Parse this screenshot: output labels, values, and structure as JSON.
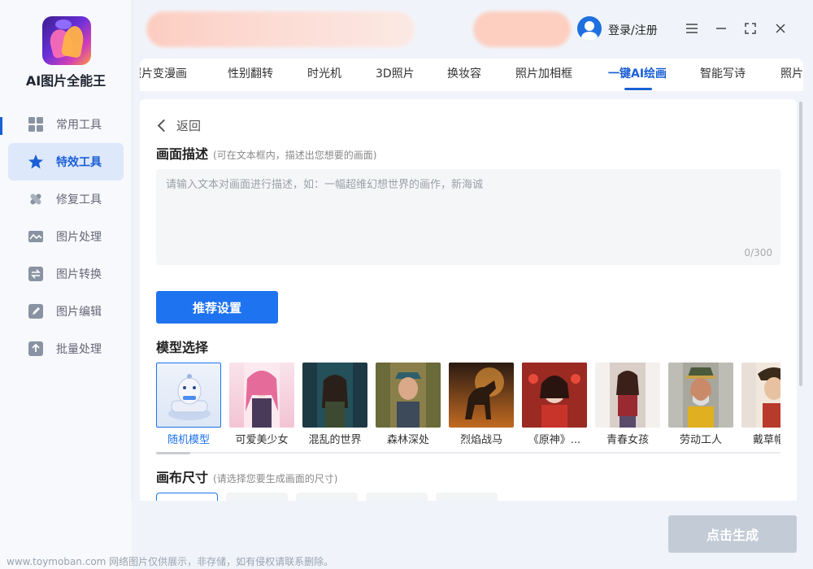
{
  "app": {
    "name": "AI图片全能王"
  },
  "header": {
    "login": "登录/注册"
  },
  "sidebar": {
    "items": [
      {
        "label": "常用工具",
        "icon": "grid-icon"
      },
      {
        "label": "特效工具",
        "icon": "star-icon",
        "active": true
      },
      {
        "label": "修复工具",
        "icon": "bandage-icon"
      },
      {
        "label": "图片处理",
        "icon": "image-icon"
      },
      {
        "label": "图片转换",
        "icon": "convert-icon"
      },
      {
        "label": "图片编辑",
        "icon": "edit-icon"
      },
      {
        "label": "批量处理",
        "icon": "upload-icon"
      }
    ]
  },
  "tabs": [
    {
      "label": "照片变漫画"
    },
    {
      "label": "性别翻转"
    },
    {
      "label": "时光机"
    },
    {
      "label": "3D照片"
    },
    {
      "label": "换妆容"
    },
    {
      "label": "照片加相框"
    },
    {
      "label": "一键AI绘画",
      "active": true
    },
    {
      "label": "智能写诗"
    },
    {
      "label": "照片"
    }
  ],
  "main": {
    "back": "返回",
    "description": {
      "title": "画面描述",
      "hint": "(可在文本框内，描述出您想要的画面)",
      "placeholder": "请输入文本对画面进行描述，如：一幅超维幻想世界的画作，新海诚",
      "counter": "0/300"
    },
    "recommend_button": "推荐设置",
    "model_section": {
      "title": "模型选择",
      "models": [
        {
          "label": "随机模型",
          "active": true
        },
        {
          "label": "可爱美少女"
        },
        {
          "label": "混乱的世界"
        },
        {
          "label": "森林深处"
        },
        {
          "label": "烈焰战马"
        },
        {
          "label": "《原神》..."
        },
        {
          "label": "青春女孩"
        },
        {
          "label": "劳动工人"
        },
        {
          "label": "戴草帽的"
        }
      ]
    },
    "canvas_section": {
      "title": "画布尺寸",
      "hint": "(请选择您要生成画面的尺寸)"
    }
  },
  "footer": {
    "generate_button": "点击生成",
    "watermark": "www.toymoban.com 网络图片仅供展示，非存储，如有侵权请联系删除。"
  },
  "colors": {
    "accent": "#1e73f0",
    "active_nav_bg": "#dde8fb",
    "disabled_button": "#c3cbd6"
  }
}
